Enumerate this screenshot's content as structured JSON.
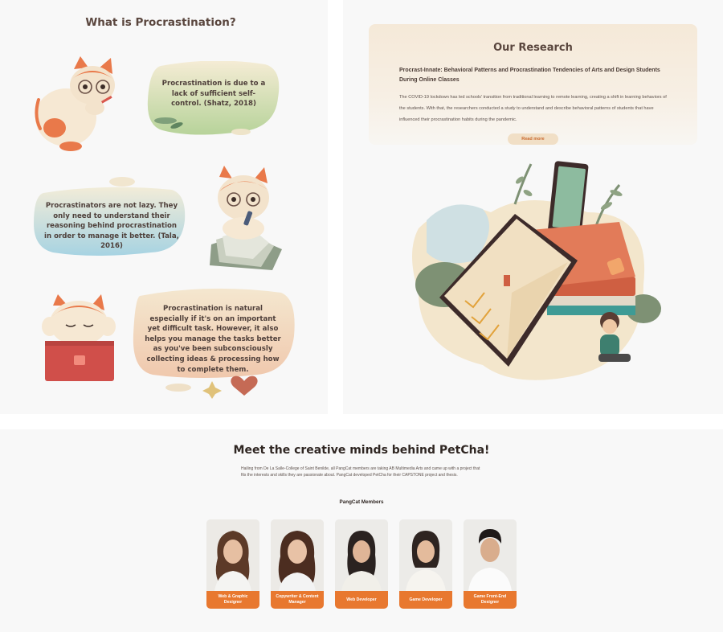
{
  "procrastination": {
    "title": "What is Procrastination?",
    "quotes": [
      "Procrastination is due to a lack of sufficient self-control. (Shatz, 2018)",
      "Procrastinators are not lazy. They only need to understand their reasoning behind procrastination in order to manage it better. (Tala, 2016)",
      "Procrastination is natural especially if it's on an important yet difficult task. However, it also helps you manage the tasks better as you've been subconsciously collecting ideas & processing how to complete them."
    ]
  },
  "research": {
    "heading": "Our Research",
    "subtitle": "Procrast-Innate: Behavioral Patterns and Procrastination Tendencies of Arts and Design Students During Online Classes",
    "body": "The COVID-19 lockdown has led schools' transition from traditional learning to remote learning, creating a shift in learning behaviors of the students. With that, the researchers conducted a study to understand and describe behavioral patterns of students that have influenced their procrastination habits during the pandemic.",
    "read_more": "Read more"
  },
  "team": {
    "title": "Meet the creative minds behind PetCha!",
    "intro": "Hailing from De La Salle-College of Saint Benilde, all PangCat members are taking AB Multimedia Arts and came up with a project that fits the interests and skills they are passionate about. PangCat developed PetCha for their CAPSTONE project and thesis.",
    "members_label": "PangCat Members",
    "members": [
      {
        "role": "Web & Graphic Designer"
      },
      {
        "role": "Copywriter & Content Manager"
      },
      {
        "role": "Web Developer"
      },
      {
        "role": "Game Developer"
      },
      {
        "role": "Game Front-End Designer"
      }
    ]
  },
  "colors": {
    "accent_orange": "#e8782f",
    "heading_brown": "#5a463e",
    "panel_background": "#f8f8f8"
  }
}
